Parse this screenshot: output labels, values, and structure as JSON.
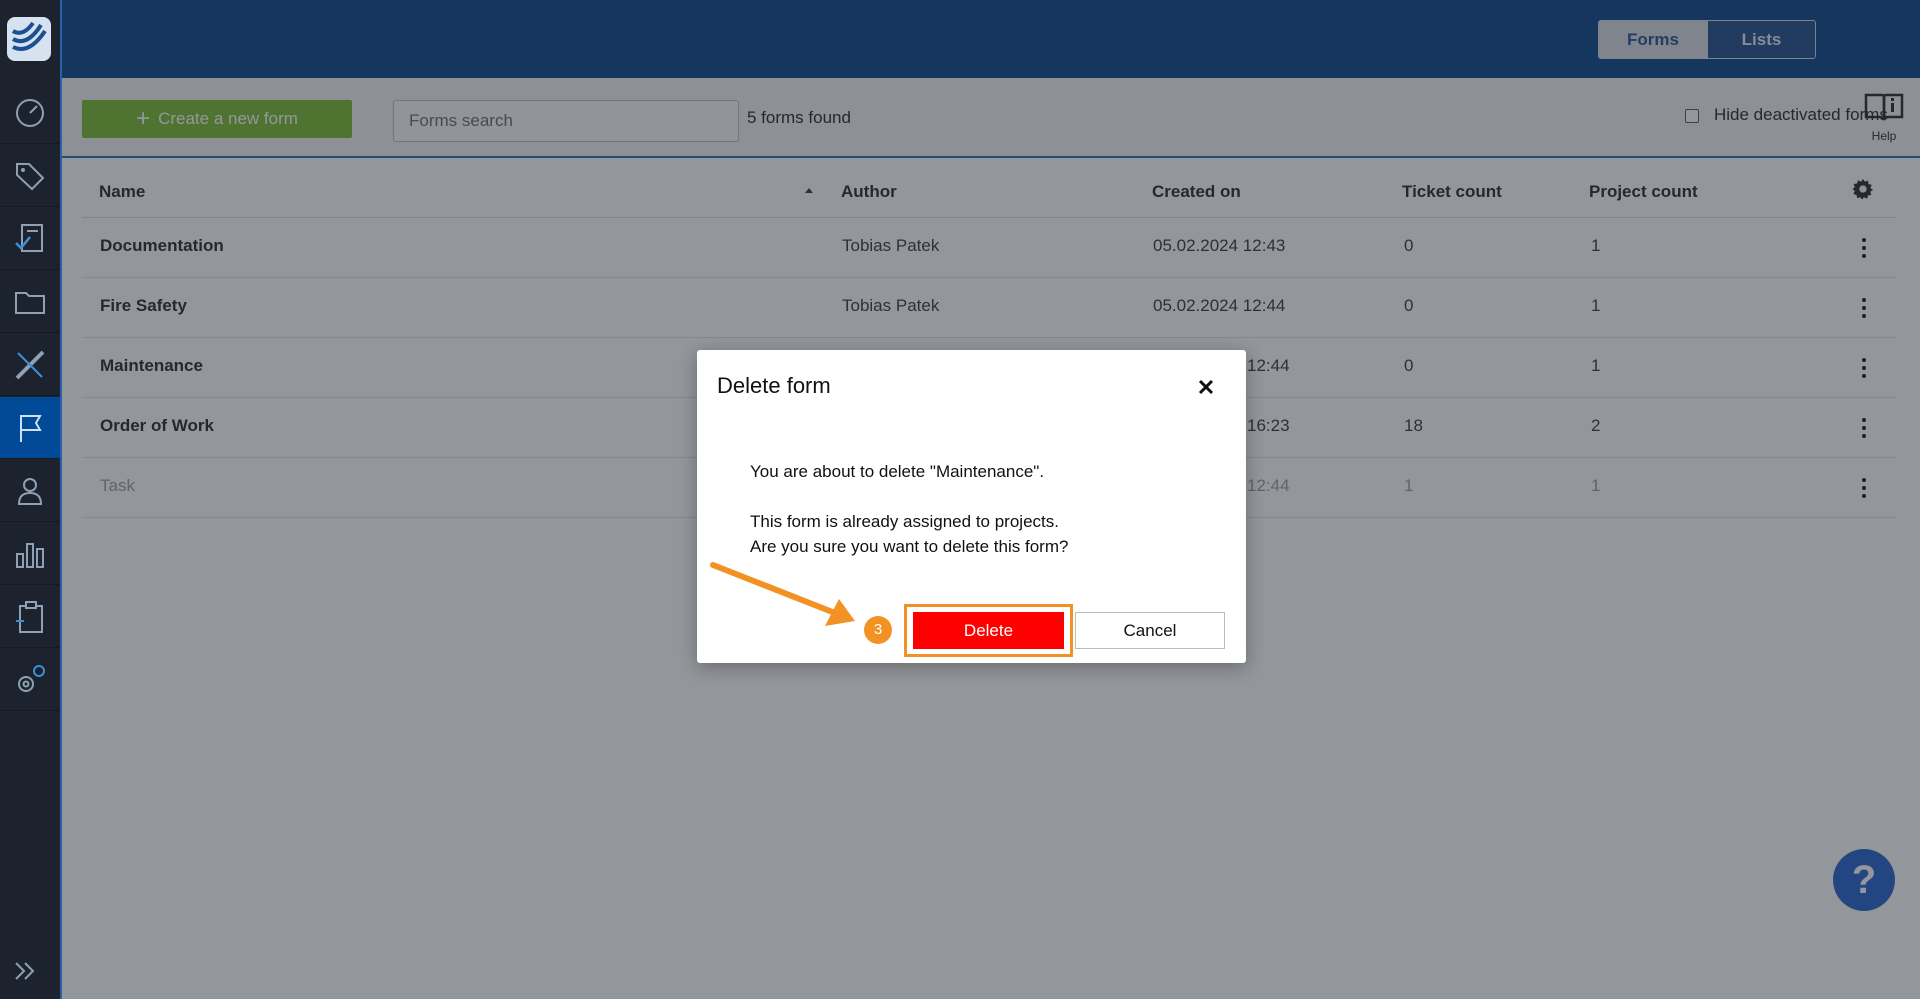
{
  "header": {
    "tabs": [
      {
        "label": "Forms",
        "active": true
      },
      {
        "label": "Lists",
        "active": false
      }
    ],
    "notification_dot_color": "#f5a623"
  },
  "sidebar": {
    "icons": [
      "dashboard-icon",
      "tag-icon",
      "form-check-icon",
      "folder-icon",
      "ruler-pencil-icon",
      "flag-icon",
      "user-icon",
      "bar-chart-icon",
      "clipboard-icon",
      "settings-icon"
    ],
    "active_index": 5
  },
  "toolbar": {
    "create_label": "Create a new form",
    "search_placeholder": "Forms search",
    "found_text": "5 forms found",
    "hide_deactivated_label": "Hide deactivated forms",
    "help_label": "Help"
  },
  "table": {
    "columns": [
      "Name",
      "Author",
      "Created on",
      "Ticket count",
      "Project count"
    ],
    "rows": [
      {
        "name": "Documentation",
        "author": "Tobias Patek",
        "created": "05.02.2024 12:43",
        "tickets": "0",
        "projects": "1"
      },
      {
        "name": "Fire Safety",
        "author": "Tobias Patek",
        "created": "05.02.2024 12:44",
        "tickets": "0",
        "projects": "1"
      },
      {
        "name": "Maintenance",
        "author": "",
        "created": "12:44",
        "tickets": "0",
        "projects": "1"
      },
      {
        "name": "Order of Work",
        "author": "",
        "created": "16:23",
        "tickets": "18",
        "projects": "2"
      },
      {
        "name": "Task",
        "author": "",
        "created": "12:44",
        "tickets": "1",
        "projects": "1"
      }
    ]
  },
  "modal": {
    "title": "Delete form",
    "line1": "You are about to delete \"Maintenance\".",
    "line2": "This form is already assigned to projects.",
    "line3": "Are you sure you want to delete this form?",
    "delete_label": "Delete",
    "cancel_label": "Cancel",
    "step_number": "3"
  },
  "fab": {
    "label": "?"
  },
  "colors": {
    "accent": "#003f87",
    "create": "#76b82a",
    "delete": "#ff0000",
    "highlight": "#f39224"
  }
}
